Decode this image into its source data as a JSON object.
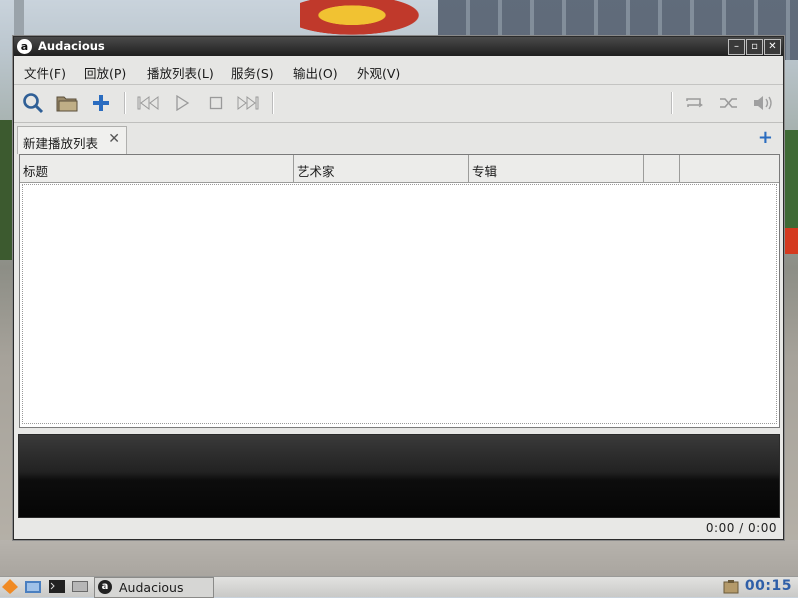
{
  "window": {
    "title": "Audacious",
    "app_icon_glyph": "a",
    "controls": [
      "minimize",
      "maximize",
      "close"
    ]
  },
  "menu": [
    "文件(F)",
    "回放(P)",
    "播放列表(L)",
    "服务(S)",
    "输出(O)",
    "外观(V)"
  ],
  "toolbar": {
    "buttons": [
      "search-icon",
      "open-folder-icon",
      "add-icon",
      "previous-icon",
      "play-icon",
      "stop-icon",
      "next-icon",
      "repeat-icon",
      "shuffle-icon",
      "volume-icon"
    ]
  },
  "tabs": [
    {
      "label": "新建播放列表"
    }
  ],
  "playlist": {
    "columns": [
      "标题",
      "艺术家",
      "专辑",
      "",
      ""
    ]
  },
  "status": {
    "time": "0:00 / 0:00"
  },
  "taskbar": {
    "task_label": "Audacious",
    "clock": "00:15"
  },
  "colors": {
    "accent": "#2a6cc0",
    "titlebar": "#2b2b2b"
  }
}
